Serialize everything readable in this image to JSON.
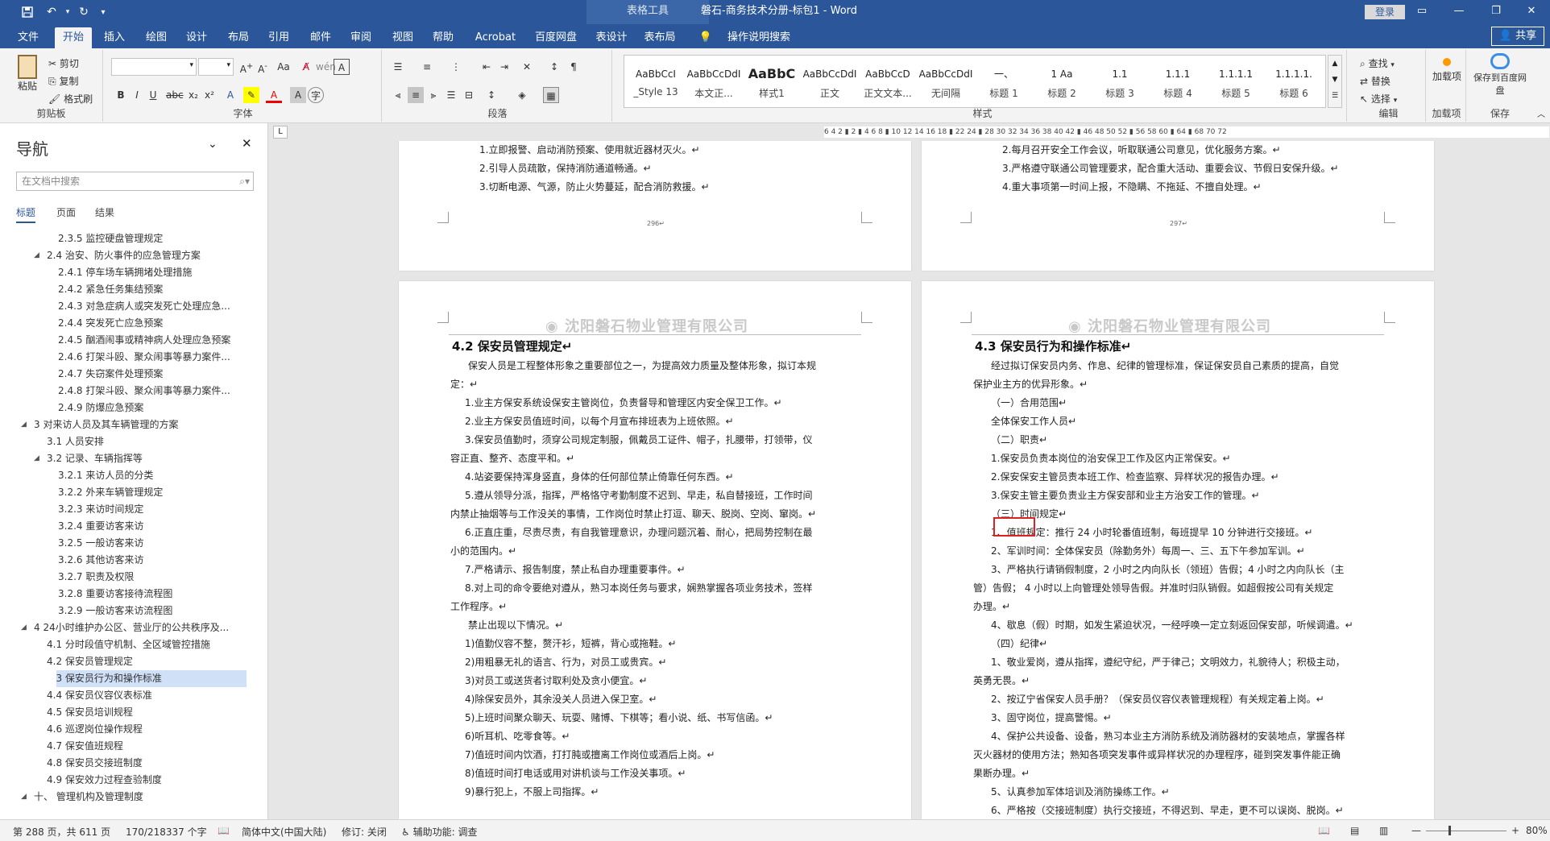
{
  "titlebar": {
    "context_tab": "表格工具",
    "doc_title": "磐石-商务技术分册-标包1  -  Word",
    "login": "登录",
    "save_icon": "save-icon",
    "undo_icon": "undo-icon",
    "redo_icon": "redo-icon"
  },
  "tabs": [
    "文件",
    "开始",
    "插入",
    "绘图",
    "设计",
    "布局",
    "引用",
    "邮件",
    "审阅",
    "视图",
    "帮助",
    "Acrobat",
    "百度网盘",
    "表设计",
    "表布局",
    "操作说明搜索"
  ],
  "share": "共享",
  "ribbon": {
    "clipboard": {
      "paste": "粘贴",
      "cut": "剪切",
      "copy": "复制",
      "format_painter": "格式刷",
      "label": "剪贴板"
    },
    "font": {
      "label": "字体"
    },
    "paragraph": {
      "label": "段落"
    },
    "styles": {
      "label": "样式",
      "items": [
        {
          "sample": "AaBbCcI",
          "name": "_Style 13"
        },
        {
          "sample": "AaBbCcDdI",
          "name": "本文正..."
        },
        {
          "sample": "AaBbC",
          "name": "样式1"
        },
        {
          "sample": "AaBbCcDdI",
          "name": "正文"
        },
        {
          "sample": "AaBbCcD",
          "name": "正文文本..."
        },
        {
          "sample": "AaBbCcDdI",
          "name": "无间隔"
        },
        {
          "sample": "一、",
          "name": "标题 1"
        },
        {
          "sample": "1 Aa",
          "name": "标题 2"
        },
        {
          "sample": "1.1",
          "name": "标题 3"
        },
        {
          "sample": "1.1.1",
          "name": "标题 4"
        },
        {
          "sample": "1.1.1.1",
          "name": "标题 5"
        },
        {
          "sample": "1.1.1.1.",
          "name": "标题 6"
        }
      ]
    },
    "editing": {
      "find": "查找",
      "replace": "替换",
      "select": "选择",
      "label": "编辑"
    },
    "addins": {
      "button": "加载项",
      "label": "加载项"
    },
    "save": {
      "button": "保存到百度网盘",
      "label": "保存"
    }
  },
  "nav": {
    "title": "导航",
    "search_placeholder": "在文档中搜索",
    "tabs": [
      "标题",
      "页面",
      "结果"
    ],
    "items": [
      {
        "text": "2.3.5 监控硬盘管理规定",
        "level": 3,
        "toggle": ""
      },
      {
        "text": "2.4 治安、防火事件的应急管理方案",
        "level": 2,
        "toggle": "◢"
      },
      {
        "text": "2.4.1 停车场车辆拥堵处理措施",
        "level": 3,
        "toggle": ""
      },
      {
        "text": "2.4.2 紧急任务集结预案",
        "level": 3,
        "toggle": ""
      },
      {
        "text": "2.4.3 对急症病人或突发死亡处理应急...",
        "level": 3,
        "toggle": ""
      },
      {
        "text": "2.4.4 突发死亡应急预案",
        "level": 3,
        "toggle": ""
      },
      {
        "text": "2.4.5 酗酒闹事或精神病人处理应急预案",
        "level": 3,
        "toggle": ""
      },
      {
        "text": "2.4.6 打架斗殴、聚众闹事等暴力案件...",
        "level": 3,
        "toggle": ""
      },
      {
        "text": "2.4.7 失窃案件处理预案",
        "level": 3,
        "toggle": ""
      },
      {
        "text": "2.4.8 打架斗殴、聚众闹事等暴力案件...",
        "level": 3,
        "toggle": ""
      },
      {
        "text": "2.4.9 防爆应急预案",
        "level": 3,
        "toggle": ""
      },
      {
        "text": "3 对来访人员及其车辆管理的方案",
        "level": 1,
        "toggle": "◢"
      },
      {
        "text": "3.1 人员安排",
        "level": 2,
        "toggle": ""
      },
      {
        "text": "3.2 记录、车辆指挥等",
        "level": 2,
        "toggle": "◢"
      },
      {
        "text": "3.2.1 来访人员的分类",
        "level": 3,
        "toggle": ""
      },
      {
        "text": "3.2.2 外来车辆管理规定",
        "level": 3,
        "toggle": ""
      },
      {
        "text": "3.2.3 来访时间规定",
        "level": 3,
        "toggle": ""
      },
      {
        "text": "3.2.4 重要访客来访",
        "level": 3,
        "toggle": ""
      },
      {
        "text": "3.2.5 一般访客来访",
        "level": 3,
        "toggle": ""
      },
      {
        "text": "3.2.6 其他访客来访",
        "level": 3,
        "toggle": ""
      },
      {
        "text": "3.2.7 职责及权限",
        "level": 3,
        "toggle": ""
      },
      {
        "text": "3.2.8 重要访客接待流程图",
        "level": 3,
        "toggle": ""
      },
      {
        "text": "3.2.9 一般访客来访流程图",
        "level": 3,
        "toggle": ""
      },
      {
        "text": "4 24小时维护办公区、营业厅的公共秩序及...",
        "level": 1,
        "toggle": "◢"
      },
      {
        "text": "4.1 分时段值守机制、全区域管控措施",
        "level": 2,
        "toggle": ""
      },
      {
        "text": "4.2 保安员管理规定",
        "level": 2,
        "toggle": ""
      },
      {
        "text": "4.3 保安员行为和操作标准",
        "level": 2,
        "toggle": "",
        "selected": true
      },
      {
        "text": "4.4 保安员仪容仪表标准",
        "level": 2,
        "toggle": ""
      },
      {
        "text": "4.5 保安员培训规程",
        "level": 2,
        "toggle": ""
      },
      {
        "text": "4.6 巡逻岗位操作规程",
        "level": 2,
        "toggle": ""
      },
      {
        "text": "4.7 保安值班规程",
        "level": 2,
        "toggle": ""
      },
      {
        "text": "4.8 保安员交接班制度",
        "level": 2,
        "toggle": ""
      },
      {
        "text": "4.9 保安效力过程查验制度",
        "level": 2,
        "toggle": ""
      },
      {
        "text": "十、 管理机构及管理制度",
        "level": 1,
        "toggle": "◢"
      }
    ]
  },
  "ruler": {
    "ticks": "6 4 2 ▮ 2 ▮ 4 6 8 ▮ 10 12 14 16 18 ▮ 22 24 ▮ 28 30 32 34 36 38 40 42 ▮ 46 48 50 52 ▮ 56 58 60 ▮ 64 ▮ 68 70 72"
  },
  "pages": {
    "top_left": {
      "lines": [
        "1.立即报警、启动消防预案、使用就近器材灭火。↵",
        "2.引导人员疏散，保持消防通道畅通。↵",
        "3.切断电源、气源，防止火势蔓延，配合消防救援。↵"
      ],
      "page_num": "296↵"
    },
    "top_right": {
      "lines": [
        "2.每月召开安全工作会议，听取联通公司意见，优化服务方案。↵",
        "3.严格遵守联通公司管理要求，配合重大活动、重要会议、节假日安保升级。↵",
        "4.重大事项第一时间上报，不隐瞒、不拖延、不擅自处理。↵"
      ],
      "page_num": "297↵"
    },
    "company": "沈阳磐石物业管理有限公司",
    "left": {
      "heading": "4.2 保安员管理规定↵",
      "lines": [
        "保安人员是工程整体形象之重要部位之一，为提高效力质量及整体形象，拟订本规",
        "定：↵",
        "1.业主方保安系统设保安主管岗位，负责督导和管理区内安全保卫工作。↵",
        "2.业主方保安员值班时间，以每个月宣布排班表为上班依照。↵",
        "3.保安员值勤时，须穿公司规定制服，佩戴员工证件、帽子，扎腰带，打领带，仪",
        "容正直、整齐、态度平和。↵",
        "4.站姿要保持浑身竖直，身体的任何部位禁止倚靠任何东西。↵",
        "5.遵从领导分派，指挥，严格恪守考勤制度不迟到、早走，私自替接班，工作时间",
        "内禁止抽烟等与工作没关的事情，工作岗位时禁止打逗、聊天、脱岗、空岗、窜岗。↵",
        "6.正直庄重，尽责尽责，有自我管理意识，办理问题沉着、耐心，把局势控制在最",
        "小的范围内。↵",
        "7.严格请示、报告制度，禁止私自办理重要事件。↵",
        "8.对上司的命令要绝对遵从，熟习本岗任务与要求，娴熟掌握各项业务技术，签样",
        "工作程序。↵",
        "禁止出现以下情况。↵",
        "1)值勤仪容不整，赘汗衫，短裤，背心或拖鞋。↵",
        "2)用粗暴无礼的语言、行为，对员工或贵宾。↵",
        "3)对员工或送货者讨取利处及贪小便宜。↵",
        "4)除保安员外，其余没关人员进入保卫室。↵",
        "5)上班时间聚众聊天、玩耍、赌博、下棋等；看小说、纸、书写信函。↵",
        "6)听耳机、吃零食等。↵",
        "7)值班时间内饮酒，打打肫或擅离工作岗位或酒后上岗。↵",
        "8)值班时间打电话或用对讲机谈与工作没关事项。↵",
        "9)暴行犯上，不服上司指挥。↵"
      ]
    },
    "right": {
      "heading": "4.3 保安员行为和操作标准↵",
      "lines": [
        "经过拟订保安员内务、作息、纪律的管理标准，保证保安员自己素质的提高，自觉",
        "保护业主方的优异形象。↵",
        "（一）合用范围↵",
        "全体保安工作人员↵",
        "（二）职责↵",
        "1.保安员负责本岗位的治安保卫工作及区内正常保安。↵",
        "2.保安保安主管员责本班工作、检查监察、异样状况的报告办理。↵",
        "3.保安主管主要负责业主方保安部和业主方治安工作的管理。↵",
        "（三）时间规定↵",
        "1、值班规定：推行 24 小时轮番值班制，每班提早 10 分钟进行交接班。↵",
        "2、军训时间：全体保安员（除勤务外）每周一、三、五下午参加军训。↵",
        "3、严格执行请销假制度，2 小时之内向队长（领班）告假；4 小时之内向队长（主",
        "管）告假；  4 小时以上向管理处领导告假。并准时归队销假。如超假按公司有关规定",
        "办理。↵",
        "4、歇息（假）时期，如发生紧迫状况，一经呼唤一定立刻返回保安部，听候调遣。↵",
        "（四）纪律↵",
        "1、敬业爱岗，遵从指挥，遵纪守纪，严于律己；文明效力，礼貌待人；积极主动，",
        "英勇无畏。↵",
        "2、按辽宁省保安人员手册？（保安员仪容仪表管理规程）有关规定着上岗。↵",
        "3、固守岗位，提高警惕。↵",
        "4、保护公共设备、设备，熟习本业主方消防系统及消防器材的安装地点，掌握各样",
        "灭火器材的使用方法；熟知各项突发事件或异样状况的办理程序，碰到突发事件能正确",
        "果断办理。↵",
        "5、认真参加军体培训及消防操练工作。↵",
        "6、严格按（交接班制度）执行交接班，不得迟到、早走，更不可以误岗、脱岗。↵"
      ]
    }
  },
  "status": {
    "page": "第 288 页，共 611 页",
    "words": "170/218337 个字",
    "lang": "简体中文(中国大陆)",
    "revision": "修订: 关闭",
    "access": "辅助功能: 调查",
    "zoom": "80%"
  }
}
